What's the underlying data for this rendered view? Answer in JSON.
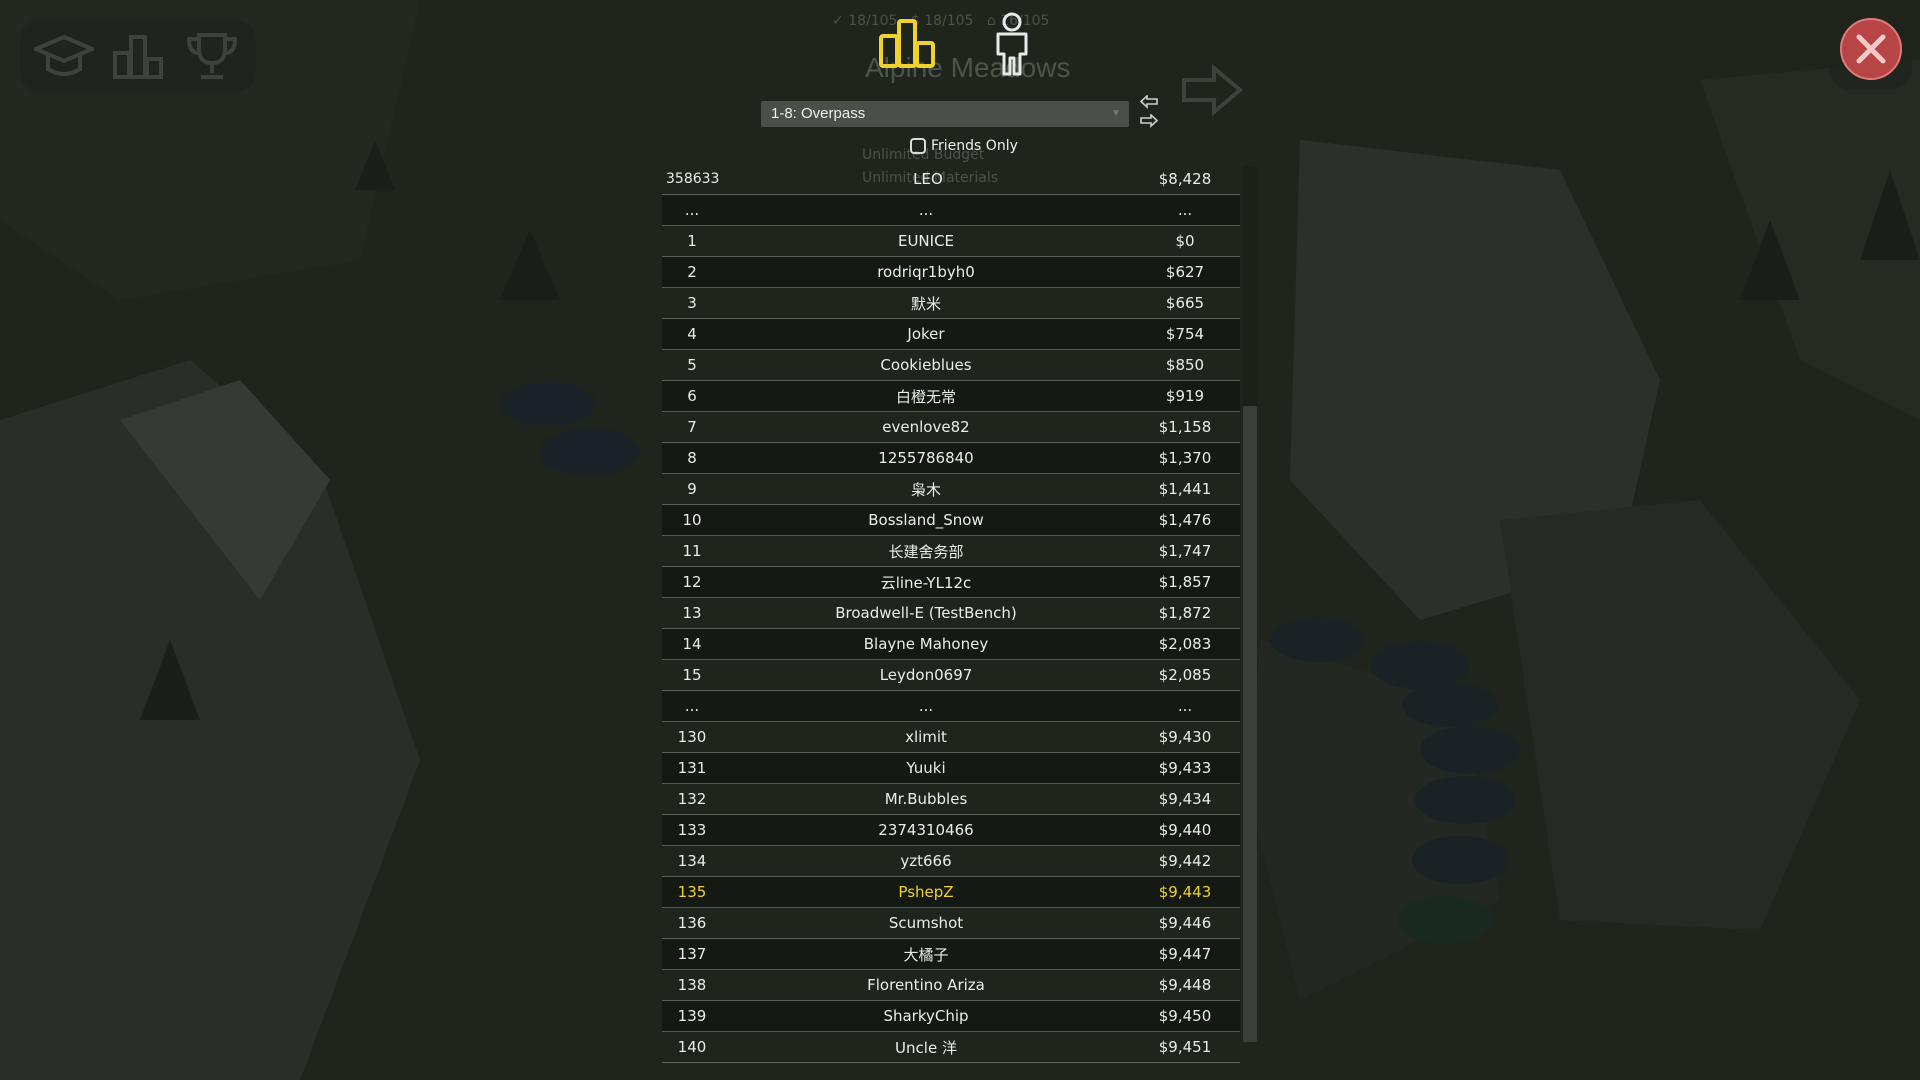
{
  "background": {
    "level_title": "Alpine Meadows",
    "stats": [
      {
        "icon": "checkmark-icon",
        "text": "18/105"
      },
      {
        "icon": "dollar-icon",
        "text": "18/105"
      },
      {
        "icon": "budget-icon",
        "text": "16/105"
      }
    ],
    "hidden_options": [
      "Unlimited Budget",
      "Unlimited Materials"
    ]
  },
  "top_menu": [
    {
      "name": "campaign",
      "icon": "graduation-cap-icon"
    },
    {
      "name": "leaderboards",
      "icon": "podium-icon"
    },
    {
      "name": "achievements",
      "icon": "trophy-icon"
    }
  ],
  "tabs": [
    {
      "name": "global",
      "icon": "podium-icon",
      "active": true
    },
    {
      "name": "friends",
      "icon": "person-icon",
      "active": false
    }
  ],
  "colors": {
    "accent": "#f0d22e",
    "close": "#b84545"
  },
  "level_selector": {
    "value": "1-8: Overpass"
  },
  "friends_only": {
    "label": "Friends Only",
    "checked": false
  },
  "top_entry": {
    "rank": "358633",
    "name": "LEO",
    "score": "$8,428"
  },
  "rows": [
    {
      "rank": "...",
      "name": "...",
      "score": "..."
    },
    {
      "rank": "1",
      "name": "EUNICE",
      "score": "$0"
    },
    {
      "rank": "2",
      "name": "rodriqr1byh0",
      "score": "$627"
    },
    {
      "rank": "3",
      "name": "默米",
      "score": "$665"
    },
    {
      "rank": "4",
      "name": "Joker",
      "score": "$754"
    },
    {
      "rank": "5",
      "name": "Cookieblues",
      "score": "$850"
    },
    {
      "rank": "6",
      "name": "白橙无常",
      "score": "$919"
    },
    {
      "rank": "7",
      "name": "evenlove82",
      "score": "$1,158"
    },
    {
      "rank": "8",
      "name": "1255786840",
      "score": "$1,370"
    },
    {
      "rank": "9",
      "name": "枭木",
      "score": "$1,441"
    },
    {
      "rank": "10",
      "name": "Bossland_Snow",
      "score": "$1,476"
    },
    {
      "rank": "11",
      "name": "长建舍务部",
      "score": "$1,747"
    },
    {
      "rank": "12",
      "name": "云line-YL12c",
      "score": "$1,857"
    },
    {
      "rank": "13",
      "name": "Broadwell-E (TestBench)",
      "score": "$1,872"
    },
    {
      "rank": "14",
      "name": "Blayne Mahoney",
      "score": "$2,083"
    },
    {
      "rank": "15",
      "name": "Leydon0697",
      "score": "$2,085"
    },
    {
      "rank": "...",
      "name": "...",
      "score": "..."
    },
    {
      "rank": "130",
      "name": "xlimit",
      "score": "$9,430"
    },
    {
      "rank": "131",
      "name": "Yuuki",
      "score": "$9,433"
    },
    {
      "rank": "132",
      "name": "Mr.Bubbles",
      "score": "$9,434"
    },
    {
      "rank": "133",
      "name": "2374310466",
      "score": "$9,440"
    },
    {
      "rank": "134",
      "name": "yzt666",
      "score": "$9,442"
    },
    {
      "rank": "135",
      "name": "PshepZ",
      "score": "$9,443",
      "highlight": true
    },
    {
      "rank": "136",
      "name": "Scumshot",
      "score": "$9,446"
    },
    {
      "rank": "137",
      "name": "大橘子",
      "score": "$9,447"
    },
    {
      "rank": "138",
      "name": "Florentino Ariza",
      "score": "$9,448"
    },
    {
      "rank": "139",
      "name": "SharkyChip",
      "score": "$9,450"
    },
    {
      "rank": "140",
      "name": "Uncle 洋",
      "score": "$9,451"
    }
  ]
}
